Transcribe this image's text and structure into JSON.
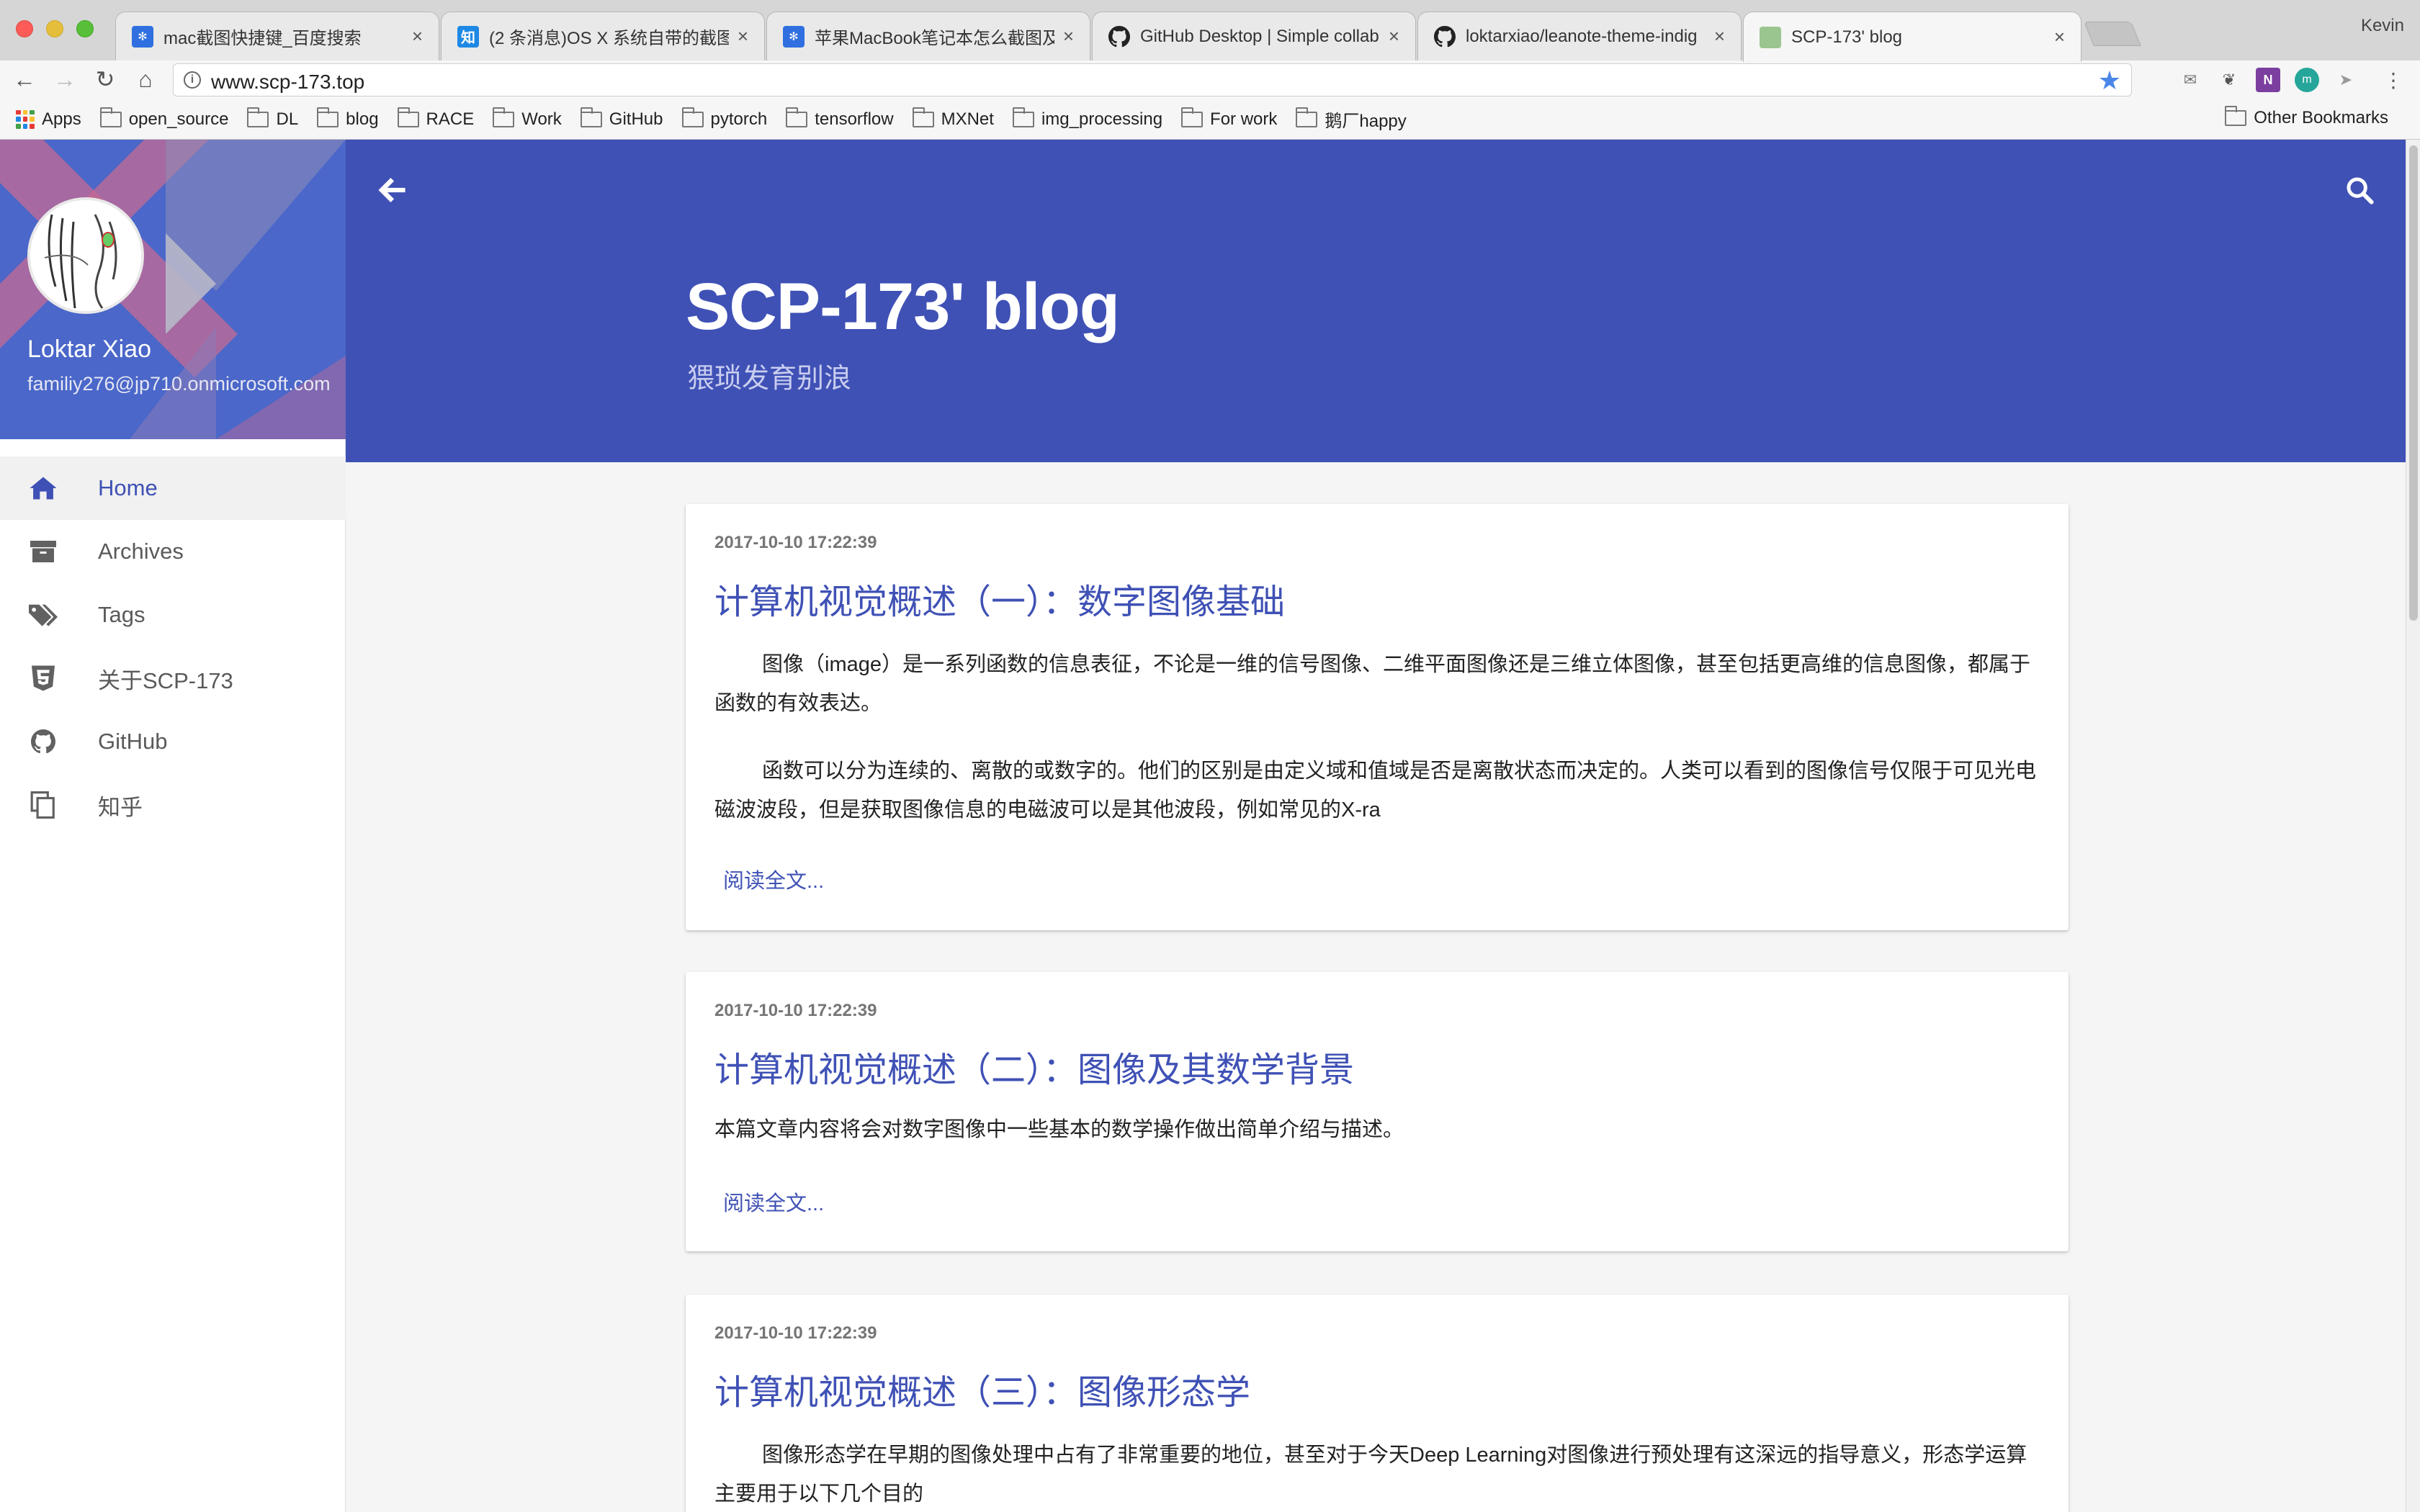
{
  "browser": {
    "tabs": [
      {
        "title": "mac截图快捷键_百度搜索",
        "fav": "baidu-paw-icon"
      },
      {
        "title": "(2 条消息)OS X 系统自带的截图",
        "fav": "zhihu-icon"
      },
      {
        "title": "苹果MacBook笔记本怎么截图及",
        "fav": "baidu-paw-icon"
      },
      {
        "title": "GitHub Desktop | Simple collab",
        "fav": "github-icon"
      },
      {
        "title": "loktarxiao/leanote-theme-indig",
        "fav": "github-icon"
      },
      {
        "title": "SCP-173' blog",
        "fav": "blog-avatar-icon"
      }
    ],
    "profile_name": "Kevin",
    "url": "www.scp-173.top",
    "bookmarks": [
      "Apps",
      "open_source",
      "DL",
      "blog",
      "RACE",
      "Work",
      "GitHub",
      "pytorch",
      "tensorflow",
      "MXNet",
      "img_processing",
      "For work",
      "鹅厂happy"
    ],
    "other_bookmarks": "Other Bookmarks"
  },
  "profile": {
    "name": "Loktar Xiao",
    "email": "familiy276@jp710.onmicrosoft.com"
  },
  "nav": [
    {
      "label": "Home",
      "icon": "home-icon",
      "active": true
    },
    {
      "label": "Archives",
      "icon": "archive-icon"
    },
    {
      "label": "Tags",
      "icon": "tags-icon"
    },
    {
      "label": "关于SCP-173",
      "icon": "html5-icon"
    },
    {
      "label": "GitHub",
      "icon": "github-icon"
    },
    {
      "label": "知乎",
      "icon": "copy-icon"
    }
  ],
  "header": {
    "title": "SCP-173' blog",
    "subtitle": "猥琐发育别浪"
  },
  "posts": [
    {
      "date": "2017-10-10 17:22:39",
      "title": "计算机视觉概述（一）：数字图像基础",
      "paragraphs": [
        "图像（image）是一系列函数的信息表征，不论是一维的信号图像、二维平面图像还是三维立体图像，甚至包括更高维的信息图像，都属于函数的有效表达。",
        "函数可以分为连续的、离散的或数字的。他们的区别是由定义域和值域是否是离散状态而决定的。人类可以看到的图像信号仅限于可见光电磁波波段，但是获取图像信息的电磁波可以是其他波段，例如常见的X-ra"
      ],
      "read_more": "阅读全文..."
    },
    {
      "date": "2017-10-10 17:22:39",
      "title": "计算机视觉概述（二）：图像及其数学背景",
      "paragraphs": [
        "本篇文章内容将会对数字图像中一些基本的数学操作做出简单介绍与描述。"
      ],
      "read_more": "阅读全文..."
    },
    {
      "date": "2017-10-10 17:22:39",
      "title": "计算机视觉概述（三）：图像形态学",
      "paragraphs": [
        "图像形态学在早期的图像处理中占有了非常重要的地位，甚至对于今天Deep Learning对图像进行预处理有这深远的指导意义，形态学运算主要用于以下几个目的"
      ],
      "read_more": ""
    }
  ],
  "colors": {
    "primary": "#3f51b5",
    "sidebar_header": "#4a67c9",
    "accent_pink": "#c56a93",
    "background": "#f5f5f5"
  }
}
